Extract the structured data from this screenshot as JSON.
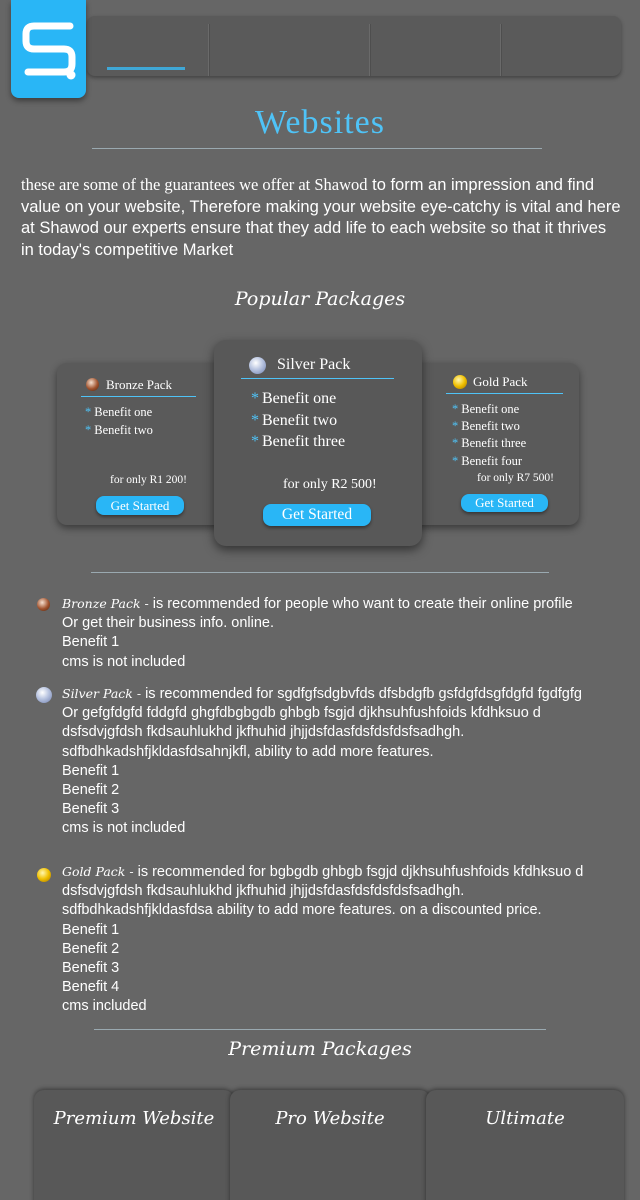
{
  "header": {
    "nav_items": [
      "",
      "",
      "",
      ""
    ],
    "colors": {
      "accent": "#29b6f6",
      "title": "#4fc3f7"
    }
  },
  "page": {
    "title": "Websites",
    "intro_serif": "these are some of the guarantees we offer at Shawod",
    "intro_rest": " to form an impression and find value on your website, Therefore making your website eye-catchy is vital and here at Shawod our experts ensure that they add life to each website so that it thrives in today's competitive Market"
  },
  "popular": {
    "heading": "Popular Packages",
    "packages": [
      {
        "name": "Bronze Pack",
        "icon": "bronze-ball-icon",
        "benefits": [
          "Benefit one",
          "Benefit two"
        ],
        "price": "for only R1 200!",
        "button": "Get Started"
      },
      {
        "name": "Silver Pack",
        "icon": "silver-ball-icon",
        "benefits": [
          "Benefit one",
          "Benefit two",
          "Benefit three"
        ],
        "price": "for only R2 500!",
        "button": "Get Started"
      },
      {
        "name": "Gold Pack",
        "icon": "gold-ball-icon",
        "benefits": [
          "Benefit one",
          "Benefit two",
          "Benefit three",
          "Benefit four"
        ],
        "price": "for only R7 500!",
        "button": "Get Started"
      }
    ]
  },
  "descriptions": [
    {
      "name": "Bronze Pack -",
      "lines": [
        " is recommended for people who want to create their online profile",
        "Or get their business info. online.",
        "Benefit 1",
        "cms is not included"
      ]
    },
    {
      "name": "Silver Pack -",
      "lines": [
        " is recommended for sgdfgfsdgbvfds dfsbdgfb gsfdgfdsgfdgfd fgdfgfg",
        "Or gefgfdgfd fddgfd ghgfdbgbgdb ghbgb fsgjd djkhsuhfushfoids kfdhksuo d",
        "dsfsdvjgfdsh fkdsauhlukhd jkfhuhid jhjjdsfdasfdsfdsfdsfsadhgh.",
        "sdfbdhkadshfjkldasfdsahnjkfl, ability to add more features.",
        "Benefit 1",
        "Benefit  2",
        "Benefit  3",
        "cms is not included"
      ]
    },
    {
      "name": "Gold Pack -",
      "lines": [
        " is recommended for bgbgdb ghbgb fsgjd djkhsuhfushfoids kfdhksuo d",
        "dsfsdvjgfdsh fkdsauhlukhd jkfhuhid jhjjdsfdasfdsfdsfdsfsadhgh.",
        "sdfbdhkadshfjkldasfdsa ability to add more features. on a discounted price.",
        "Benefit 1",
        "Benefit  2",
        "Benefit  3",
        "Benefit  4",
        "cms included"
      ]
    }
  ],
  "premium": {
    "heading": "Premium Packages",
    "tabs": [
      "Premium Website",
      "Pro Website",
      "Ultimate"
    ]
  }
}
